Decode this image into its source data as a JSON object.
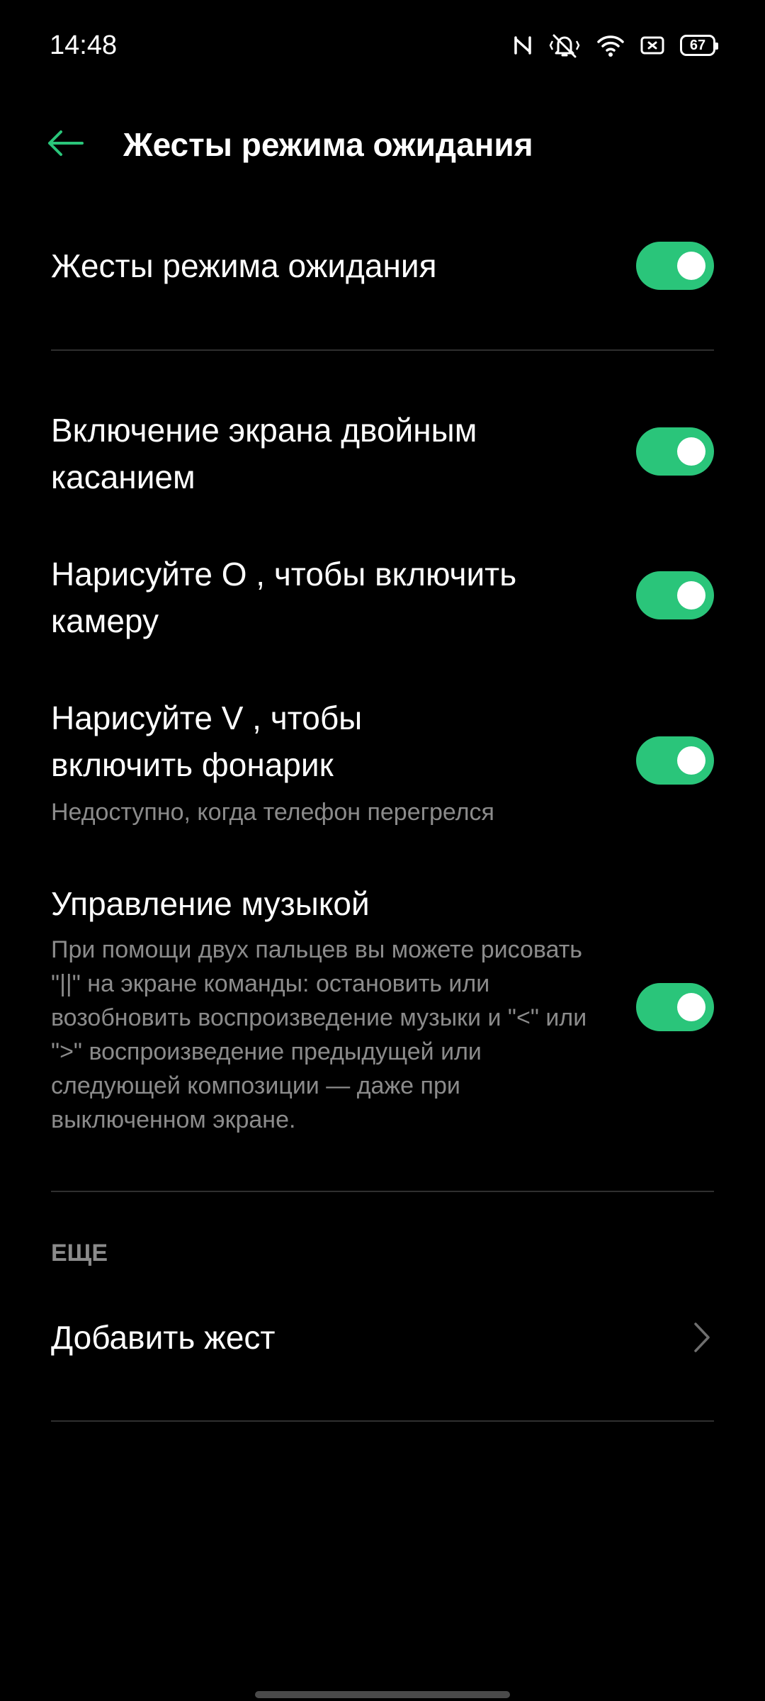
{
  "status_bar": {
    "time": "14:48",
    "icons": [
      "nfc-icon",
      "vibrate-mute-icon",
      "wifi-icon",
      "sim-icon",
      "battery-icon"
    ],
    "battery_level": "67"
  },
  "header": {
    "title": "Жесты режима ожидания",
    "back_icon": "arrow-left-icon"
  },
  "settings": {
    "master": {
      "label": "Жесты режима ожидания",
      "enabled": true
    },
    "double_tap": {
      "label": "Включение экрана двойным касанием",
      "enabled": true
    },
    "draw_o": {
      "label": "Нарисуйте  O , чтобы включить камеру",
      "enabled": true
    },
    "draw_v": {
      "label_line1": "Нарисуйте  V , чтобы",
      "label_line2": "включить фонарик",
      "description": "Недоступно, когда телефон перегрелся",
      "enabled": true
    },
    "music": {
      "label": "Управление музыкой",
      "description": "При помощи двух пальцев вы можете рисовать \"||\" на экране команды: остановить или возобновить воспроизведение музыки и \"<\" или \">\" воспроизведение предыдущей или следующей композиции — даже при выключенном экране.",
      "enabled": true
    }
  },
  "more": {
    "section_title": "ЕЩЕ",
    "add_gesture_label": "Добавить жест"
  },
  "colors": {
    "background": "#000000",
    "accent": "#2ac57a",
    "text_primary": "#ffffff",
    "text_secondary": "#8b8b8b",
    "divider": "#2f2f2f"
  }
}
